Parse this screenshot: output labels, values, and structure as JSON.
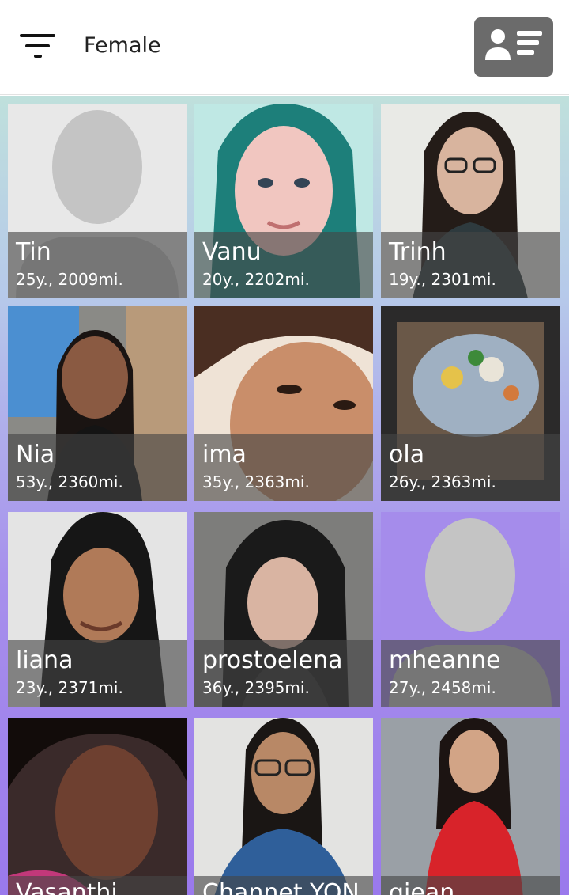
{
  "header": {
    "filter_label": "Female",
    "menu_icon": "filter-menu-icon",
    "profile_icon": "contact-card-icon"
  },
  "colors": {
    "header_bg": "#ffffff",
    "profile_button_bg": "#6b6b6b",
    "gradient_top": "#bfe0dc",
    "gradient_bottom": "#9a79ec",
    "caption_overlay": "rgba(70,70,70,0.62)"
  },
  "users": [
    {
      "name": "Tin",
      "meta": "25y., 2009mi.",
      "has_photo": false
    },
    {
      "name": "Vanu",
      "meta": "20y., 2202mi.",
      "has_photo": true
    },
    {
      "name": "Trinh",
      "meta": "19y., 2301mi.",
      "has_photo": true
    },
    {
      "name": "Nia",
      "meta": "53y., 2360mi.",
      "has_photo": true
    },
    {
      "name": "ima",
      "meta": "35y., 2363mi.",
      "has_photo": true
    },
    {
      "name": "ola",
      "meta": "26y., 2363mi.",
      "has_photo": true
    },
    {
      "name": "liana",
      "meta": "23y., 2371mi.",
      "has_photo": true
    },
    {
      "name": "prostoelena",
      "meta": "36y., 2395mi.",
      "has_photo": true
    },
    {
      "name": "mheanne",
      "meta": "27y., 2458mi.",
      "has_photo": false
    },
    {
      "name": "Vasanthi",
      "meta": "",
      "has_photo": true
    },
    {
      "name": "Channet YON",
      "meta": "",
      "has_photo": true
    },
    {
      "name": "giean",
      "meta": "",
      "has_photo": true
    }
  ]
}
